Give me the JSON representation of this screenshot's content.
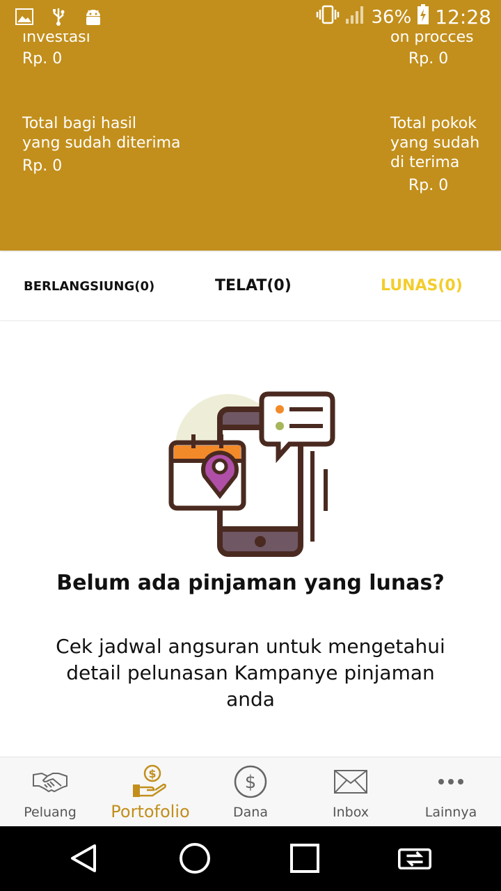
{
  "status_bar": {
    "battery_percent": "36%",
    "time": "12:28",
    "icons": [
      "image-icon",
      "usb-icon",
      "android-debug-icon",
      "vibrate-icon",
      "signal-icon",
      "battery-charging-icon"
    ]
  },
  "summary": {
    "investasi_label": "investasi",
    "investasi_value": "Rp. 0",
    "process_label": "on procces",
    "process_value": "Rp. 0",
    "bagi_hasil_label_1": "Total bagi hasil",
    "bagi_hasil_label_2": "yang sudah diterima",
    "bagi_hasil_value": "Rp. 0",
    "pokok_label_1": "Total pokok",
    "pokok_label_2": "yang sudah",
    "pokok_label_3": "di terima",
    "pokok_value": "Rp. 0"
  },
  "tabs": [
    {
      "label": "BERLANGSIUNG(0)",
      "active": false
    },
    {
      "label": "TELAT(0)",
      "active": false
    },
    {
      "label": "LUNAS(0)",
      "active": true
    }
  ],
  "empty_state": {
    "illustration": "phone-calendar-location-chat-illustration",
    "title": "Belum ada pinjaman yang lunas?",
    "description": "Cek jadwal angsuran untuk mengetahui detail pelunasan Kampanye pinjaman anda"
  },
  "bottom_nav": [
    {
      "label": "Peluang",
      "icon": "handshake-icon",
      "active": false
    },
    {
      "label": "Portofolio",
      "icon": "money-hand-icon",
      "active": true
    },
    {
      "label": "Dana",
      "icon": "dollar-circle-icon",
      "active": false
    },
    {
      "label": "Inbox",
      "icon": "envelope-icon",
      "active": false
    },
    {
      "label": "Lainnya",
      "icon": "more-dots-icon",
      "active": false
    }
  ],
  "colors": {
    "header_bg": "#c28f1c",
    "active_tab": "#f3cd2c",
    "active_nav": "#c28f1c"
  }
}
